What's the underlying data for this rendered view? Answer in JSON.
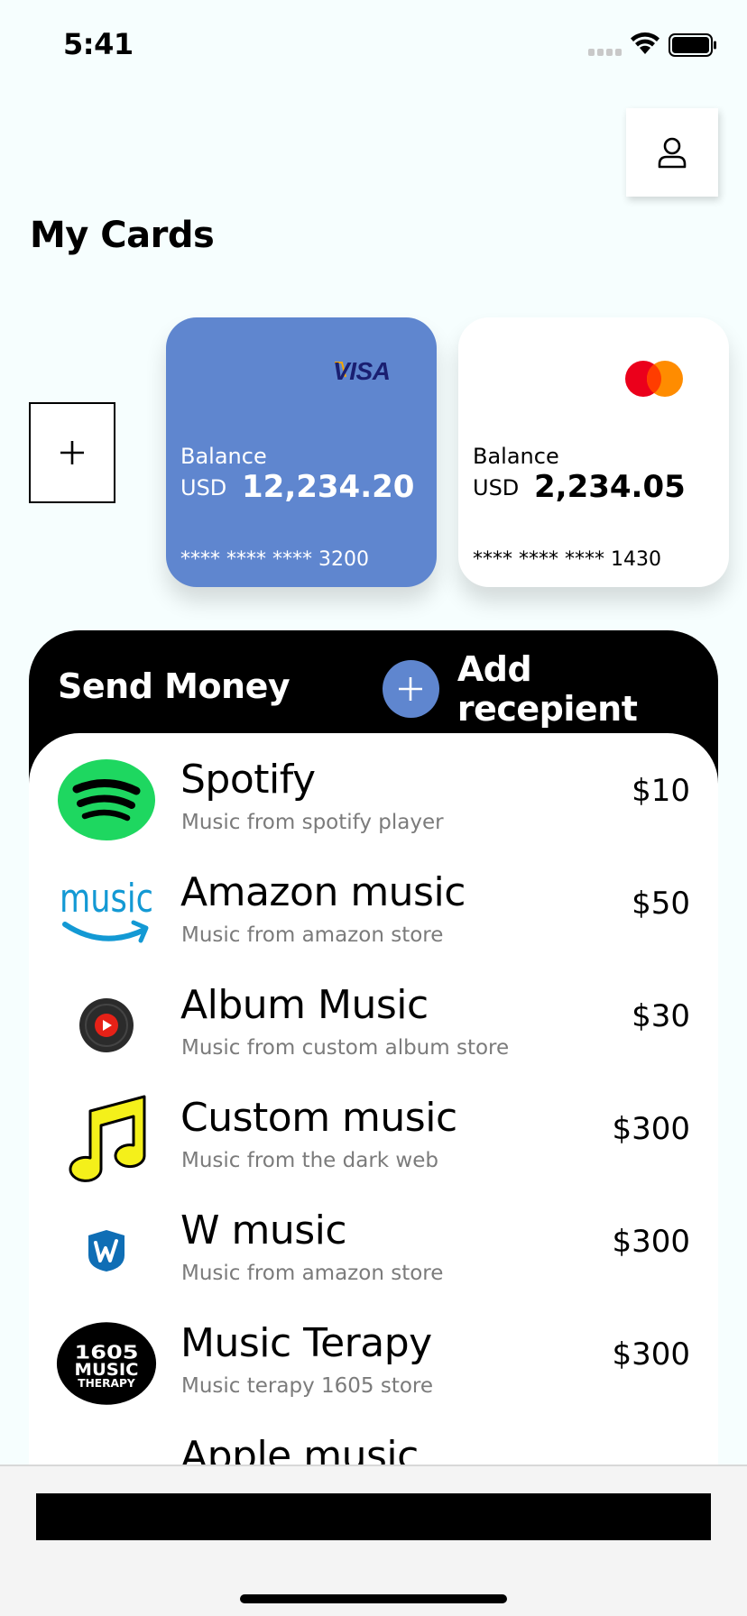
{
  "status_bar": {
    "time": "5:41"
  },
  "header": {
    "title": "My Cards",
    "profile_icon": "person-icon"
  },
  "cards": [
    {
      "brand": "VISA",
      "balance_label": "Balance",
      "currency": "USD",
      "amount": "12,234.20",
      "number": "**** **** **** 3200",
      "color": "#5f86cf"
    },
    {
      "brand": "mastercard",
      "balance_label": "Balance",
      "currency": "USD",
      "amount": "2,234.05",
      "number": "**** **** **** 1430",
      "color": "#ffffff"
    }
  ],
  "send_money": {
    "title": "Send Money",
    "add_recipient_label": "Add recepient",
    "recipients": [
      {
        "name": "Spotify",
        "description": "Music from spotify player",
        "amount": "$10",
        "icon": "spotify-icon"
      },
      {
        "name": "Amazon music",
        "description": "Music from amazon store",
        "amount": "$50",
        "icon": "amazon-music-icon"
      },
      {
        "name": "Album Music",
        "description": "Music from custom album store",
        "amount": "$30",
        "icon": "album-music-icon"
      },
      {
        "name": "Custom music",
        "description": "Music from the dark web",
        "amount": "$300",
        "icon": "music-note-icon"
      },
      {
        "name": "W music",
        "description": "Music from amazon store",
        "amount": "$300",
        "icon": "w-music-icon"
      },
      {
        "name": "Music Terapy",
        "description": "Music terapy 1605 store",
        "amount": "$300",
        "icon": "music-terapy-icon"
      },
      {
        "name": "Apple music",
        "description": "",
        "amount": "",
        "icon": ""
      }
    ]
  },
  "colors": {
    "accent": "#5f86cf",
    "spotify_green": "#1ed760",
    "amazon_blue": "#1399d4"
  }
}
